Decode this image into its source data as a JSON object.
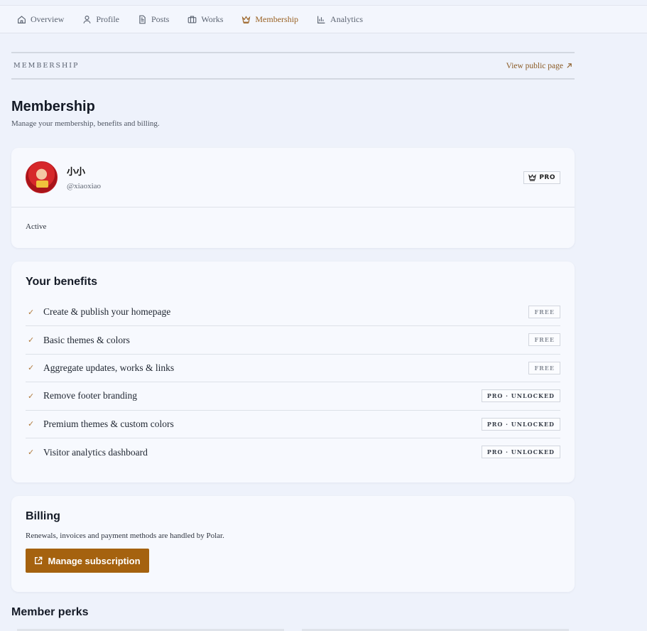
{
  "nav": {
    "tabs": [
      {
        "label": "Overview",
        "icon": "home-icon"
      },
      {
        "label": "Profile",
        "icon": "user-icon"
      },
      {
        "label": "Posts",
        "icon": "document-icon"
      },
      {
        "label": "Works",
        "icon": "briefcase-icon"
      },
      {
        "label": "Membership",
        "icon": "crown-icon",
        "active": true
      },
      {
        "label": "Analytics",
        "icon": "bar-chart-icon"
      }
    ]
  },
  "section": {
    "label": "MEMBERSHIP",
    "public_link": "View public page"
  },
  "header": {
    "title": "Membership",
    "subtitle": "Manage your membership, benefits and billing."
  },
  "profile": {
    "display_name": "小小",
    "handle": "@xiaoxiao",
    "tier": "PRO",
    "status": "Active"
  },
  "benefits": {
    "title": "Your benefits",
    "items": [
      {
        "label": "Create & publish your homepage",
        "tier": "FREE"
      },
      {
        "label": "Basic themes & colors",
        "tier": "FREE"
      },
      {
        "label": "Aggregate updates, works & links",
        "tier": "FREE"
      },
      {
        "label": "Remove footer branding",
        "tier": "PRO · UNLOCKED"
      },
      {
        "label": "Premium themes & custom colors",
        "tier": "PRO · UNLOCKED"
      },
      {
        "label": "Visitor analytics dashboard",
        "tier": "PRO · UNLOCKED"
      }
    ]
  },
  "billing": {
    "title": "Billing",
    "note": "Renewals, invoices and payment methods are handled by Polar.",
    "button_label": "Manage subscription"
  },
  "perks": {
    "title": "Member perks"
  },
  "colors": {
    "accent": "#a5620f",
    "active_tab": "#9a6224",
    "background": "#eef2fb"
  }
}
